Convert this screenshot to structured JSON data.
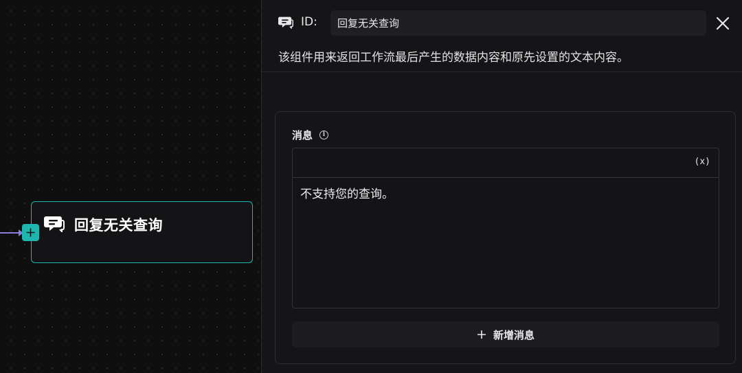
{
  "canvas": {
    "node": {
      "title": "回复无关查询",
      "icon": "chat-reply-icon"
    },
    "edge_color": "#8a7fd8",
    "accent": "#1fb6b0"
  },
  "panel": {
    "id_label": "ID:",
    "id_value": "回复无关查询",
    "header_icon": "chat-reply-icon",
    "description": "该组件用来返回工作流最后产生的数据内容和原先设置的文本内容。",
    "close_icon": "close-icon",
    "message_section": {
      "label": "消息",
      "info_icon": "info-icon",
      "variable_button": "(x)",
      "content": "不支持您的查询。"
    },
    "add_button": {
      "icon": "plus-icon",
      "label": "新增消息"
    }
  }
}
